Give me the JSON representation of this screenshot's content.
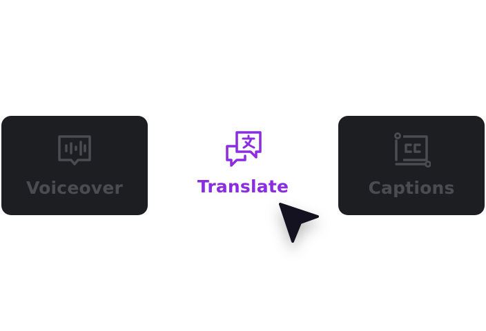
{
  "cards": {
    "voiceover": {
      "label": "Voiceover",
      "icon": "waveform-speech-icon"
    },
    "translate": {
      "label": "Translate",
      "icon": "translate-chat-icon"
    },
    "captions": {
      "label": "Captions",
      "icon": "closed-captions-icon"
    }
  },
  "colors": {
    "card_bg": "#1d1e21",
    "card_inactive_fg": "#4b4c51",
    "accent": "#8b2be2",
    "cursor": "#141220",
    "background": "#ffffff"
  }
}
